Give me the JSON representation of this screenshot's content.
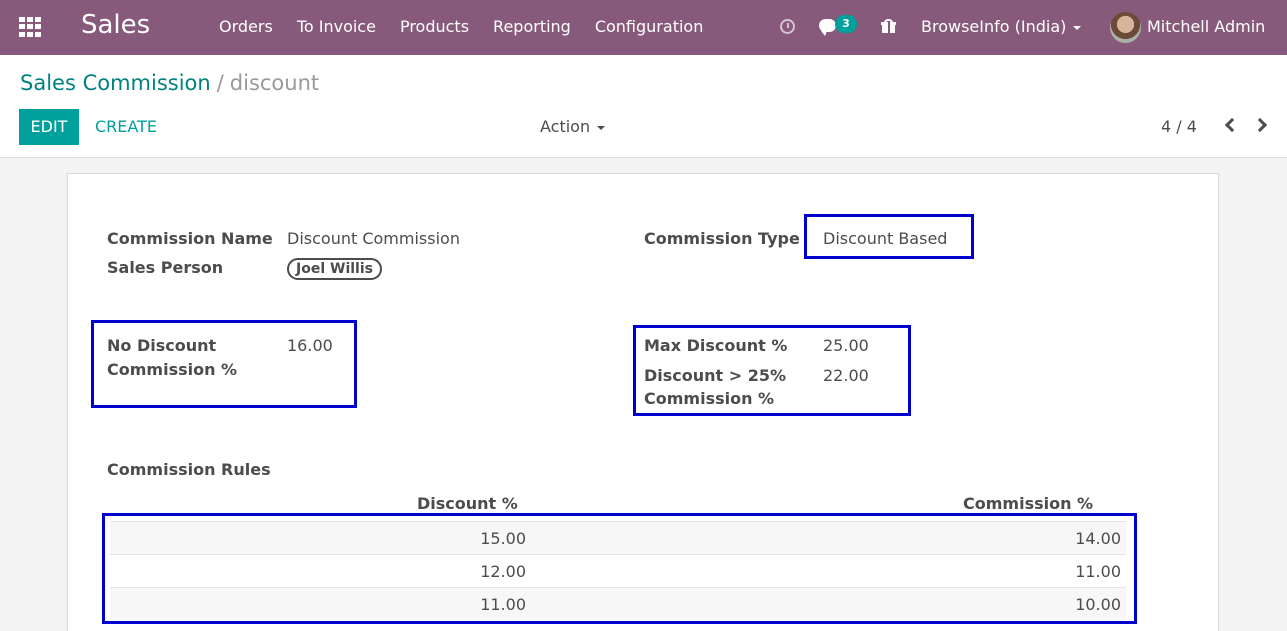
{
  "navbar": {
    "app_title": "Sales",
    "menu": [
      "Orders",
      "To Invoice",
      "Products",
      "Reporting",
      "Configuration"
    ],
    "chat_count": "3",
    "company": "BrowseInfo (India)",
    "user": "Mitchell Admin"
  },
  "control": {
    "breadcrumb_parent": "Sales Commission",
    "breadcrumb_sep": "/",
    "breadcrumb_current": "discount",
    "edit_label": "EDIT",
    "create_label": "CREATE",
    "action_label": "Action",
    "pager": "4 / 4"
  },
  "form": {
    "commission_name_label": "Commission Name",
    "commission_name_value": "Discount Commission",
    "sales_person_label": "Sales Person",
    "sales_person_value": "Joel Willis",
    "commission_type_label": "Commission Type",
    "commission_type_value": "Discount Based",
    "no_discount_label_1": "No Discount",
    "no_discount_label_2": "Commission %",
    "no_discount_value": "16.00",
    "max_discount_label": "Max Discount %",
    "max_discount_value": "25.00",
    "discount_over_label_1": "Discount > 25%",
    "discount_over_label_2": "Commission %",
    "discount_over_value": "22.00",
    "rules_title": "Commission Rules",
    "rules_headers": [
      "Discount %",
      "Commission %"
    ],
    "rules": [
      {
        "discount": "15.00",
        "commission": "14.00"
      },
      {
        "discount": "12.00",
        "commission": "11.00"
      },
      {
        "discount": "11.00",
        "commission": "10.00"
      }
    ]
  },
  "colors": {
    "navbar": "#875a7b",
    "primary": "#00a09d",
    "highlight": "#0000cc"
  }
}
